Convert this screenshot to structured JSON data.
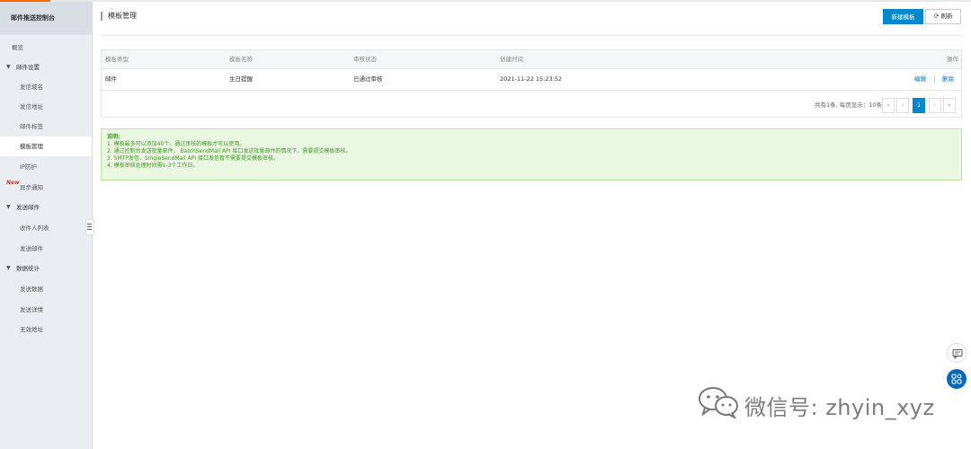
{
  "console": {
    "title": "邮件推送控制台"
  },
  "sidebar": {
    "overview": "概览",
    "groups": [
      {
        "label": "邮件设置",
        "items": [
          "发信域名",
          "发信地址",
          "邮件标签",
          "模板管理",
          "IP防护",
          "异步通知"
        ]
      },
      {
        "label": "发送邮件",
        "items": [
          "收件人列表",
          "发送邮件"
        ]
      },
      {
        "label": "数据统计",
        "items": [
          "发送数据",
          "发送详情",
          "无效地址"
        ]
      }
    ],
    "active_item": "模板管理",
    "new_badge": "New"
  },
  "header": {
    "title": "模板管理",
    "new_button": "新建模板",
    "refresh_button": "刷新"
  },
  "table": {
    "columns": [
      "模板类型",
      "模板名称",
      "审核状态",
      "创建时间",
      "操作"
    ],
    "rows": [
      {
        "type": "邮件",
        "name": "生日提醒",
        "status": "已通过审核",
        "created": "2021-11-22 15:23:52",
        "edit": "编辑",
        "delete": "删除"
      }
    ]
  },
  "pagination": {
    "summary": "共有1条, 每页显示：10条",
    "first": "«",
    "prev": "‹",
    "current": "1",
    "next": "›",
    "last": "»"
  },
  "notice": {
    "title": "说明:",
    "lines": [
      "1. 模板最多可以添加40个。通过审核的模板才可以使用。",
      "2. 通过控制台发送批量邮件、 BatchSendMail API 接口发送批量邮件的情况下，需要提交模板审核。",
      "3. SMTP发信、SingleSendMail API 接口发信暂不需要提交模板审核。",
      "4. 模板审核处理时间需1-3个工作日。"
    ]
  },
  "watermark": "微信号: zhyin_xyz",
  "icons": {
    "chat": "chat-icon",
    "apps": "apps-icon",
    "refresh": "refresh-icon",
    "caret": "caret-down-icon",
    "wechat": "wechat-logo-icon",
    "menu": "menu-icon"
  },
  "colors": {
    "primary": "#0088cc",
    "link": "#0070cc",
    "notice_bg": "#eaf8e1",
    "notice_text": "#3a9b1a",
    "new_badge": "#e0302f",
    "topbar_accent": "#ff6a00"
  }
}
